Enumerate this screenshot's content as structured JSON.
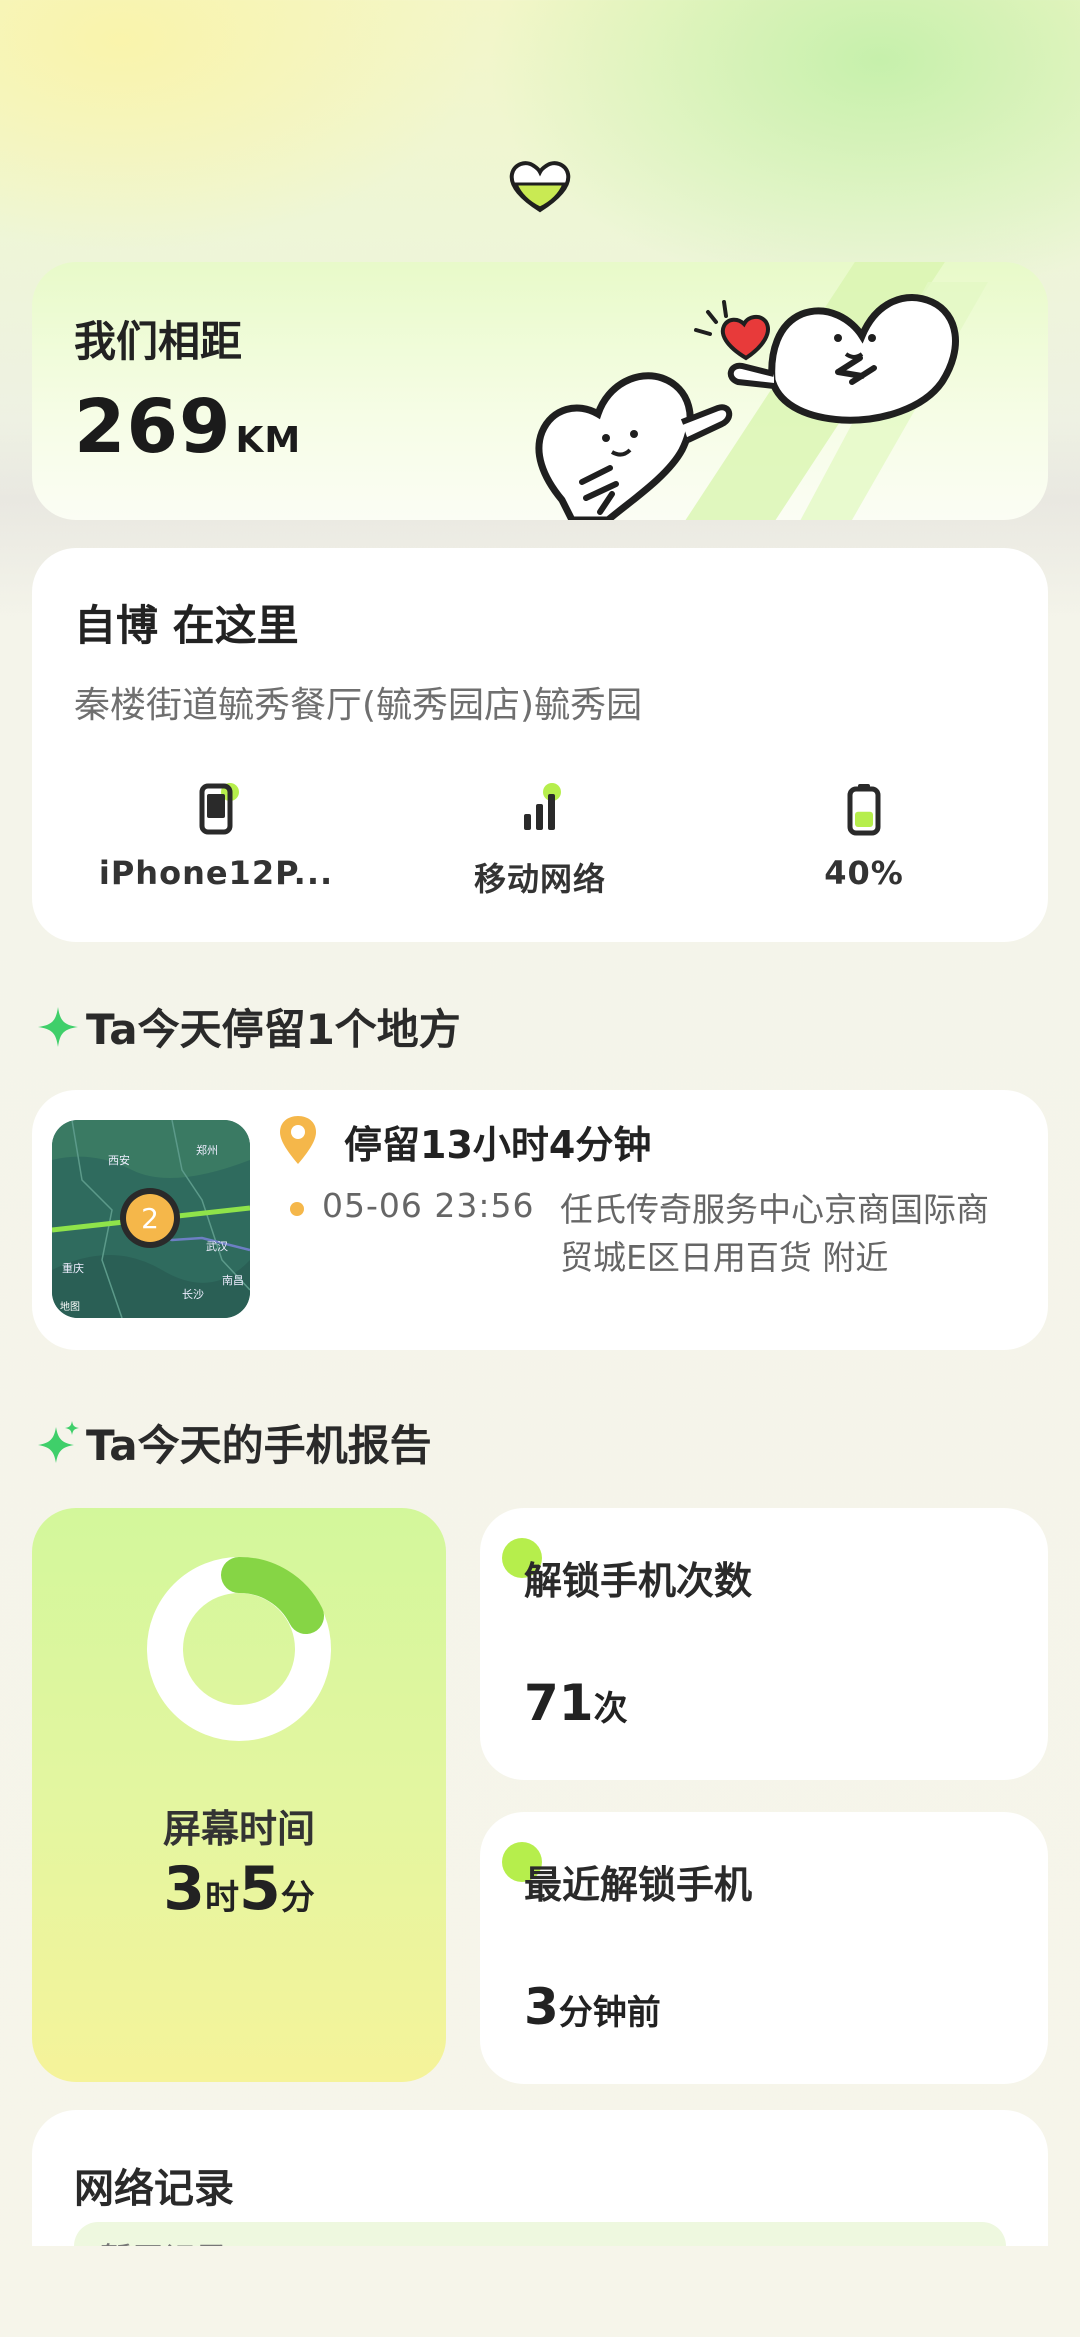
{
  "distance": {
    "title": "我们相距",
    "value": "269",
    "unit": "KM"
  },
  "location": {
    "title": "自博 在这里",
    "address": "秦楼街道毓秀餐厅(毓秀园店)毓秀园",
    "status": [
      {
        "icon": "phone-icon",
        "label": "iPhone12P..."
      },
      {
        "icon": "signal-icon",
        "label": "移动网络"
      },
      {
        "icon": "battery-icon",
        "label": "40%",
        "level": 0.4
      }
    ]
  },
  "stay_section": {
    "title": "Ta今天停留1个地方"
  },
  "stay": {
    "duration": "停留13小时4分钟",
    "time": "05-06 23:56",
    "place": "任氏传奇服务中心京商国际商贸城E区日用百货 附近",
    "map": {
      "count": "2",
      "cities": [
        "西安",
        "郑州",
        "武汉",
        "重庆",
        "长沙",
        "南昌"
      ],
      "attribution": "地图"
    }
  },
  "report_section": {
    "title": "Ta今天的手机报告"
  },
  "screen_time": {
    "label": "屏幕时间",
    "hours": "3",
    "hours_unit": "时",
    "minutes": "5",
    "minutes_unit": "分"
  },
  "unlock": {
    "title": "解锁手机次数",
    "value": "71",
    "unit": "次"
  },
  "recent_unlock": {
    "title": "最近解锁手机",
    "value": "3",
    "unit": "分钟前"
  },
  "network": {
    "title": "网络记录",
    "subtitle": "暂无记录"
  },
  "colors": {
    "accent_green": "#b6ee4c",
    "pin_orange": "#f5b74a",
    "heart_red": "#e83a3a"
  }
}
